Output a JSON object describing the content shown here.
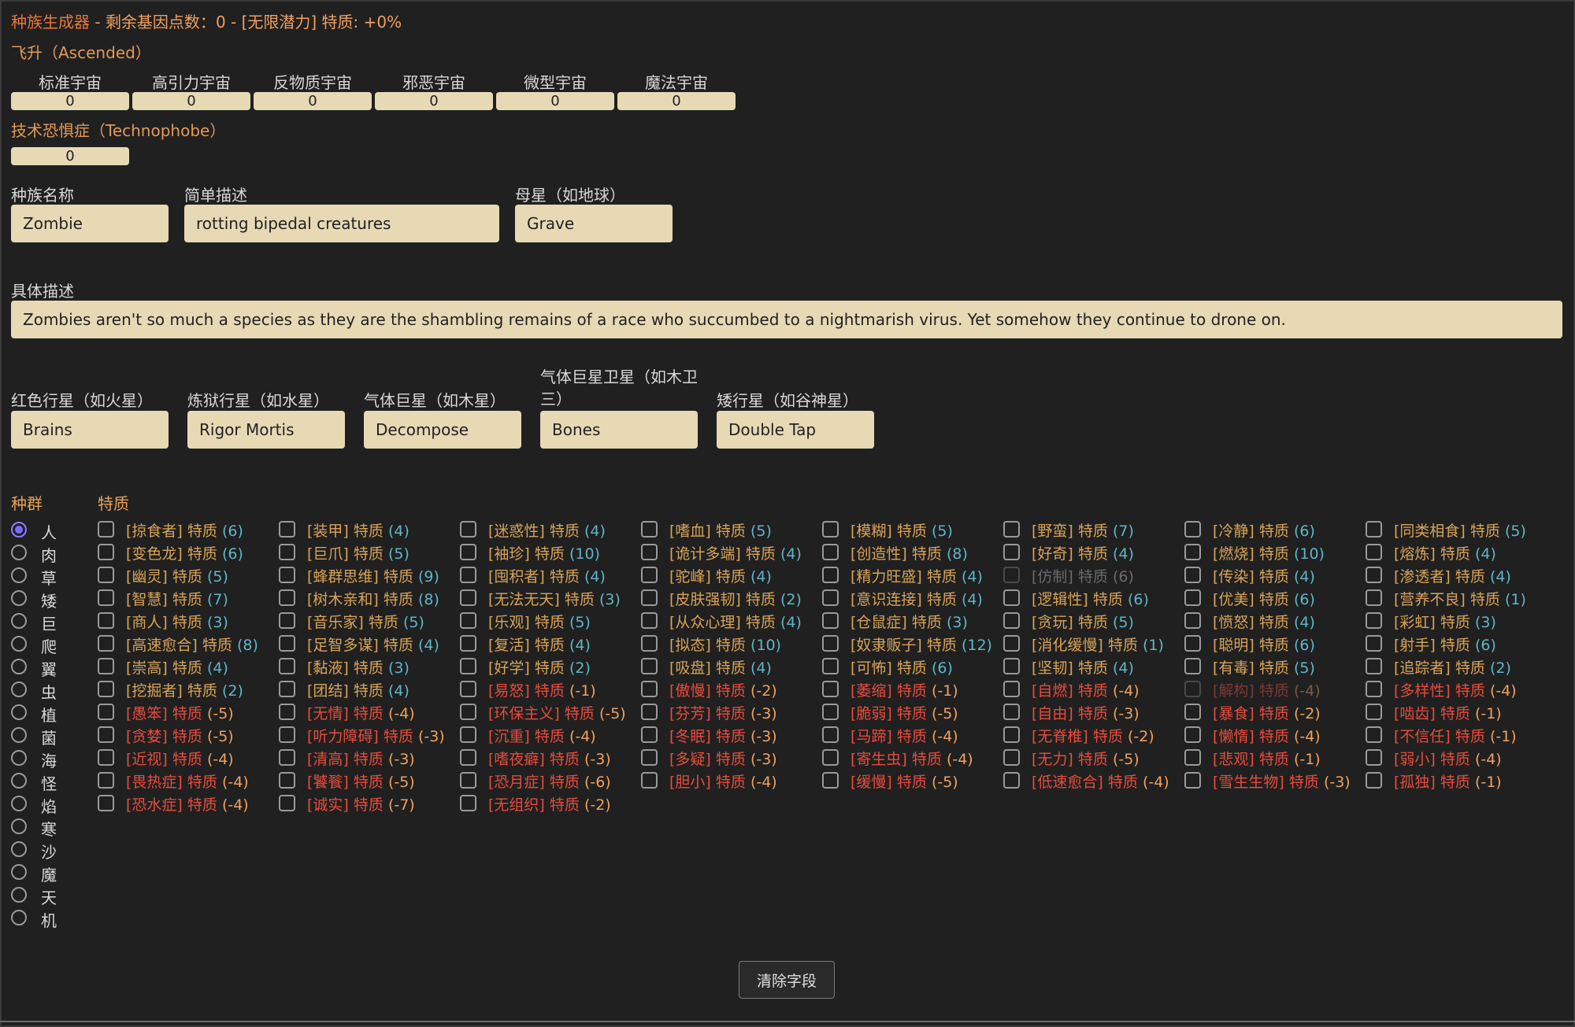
{
  "header": {
    "title": "种族生成器",
    "separator": " - ",
    "points_label": "剩余基因点数：",
    "points_value": "0 - [无限潜力] 特质: +0%"
  },
  "ascended": {
    "title": "飞升（Ascended）",
    "universes": [
      {
        "label": "标准宇宙",
        "value": "0"
      },
      {
        "label": "高引力宇宙",
        "value": "0"
      },
      {
        "label": "反物质宇宙",
        "value": "0"
      },
      {
        "label": "邪恶宇宙",
        "value": "0"
      },
      {
        "label": "微型宇宙",
        "value": "0"
      },
      {
        "label": "魔法宇宙",
        "value": "0"
      }
    ]
  },
  "technophobe": {
    "title": "技术恐惧症（Technophobe）",
    "value": "0"
  },
  "fields": {
    "name": {
      "label": "种族名称",
      "value": "Zombie"
    },
    "desc": {
      "label": "简单描述",
      "value": "rotting bipedal creatures"
    },
    "home": {
      "label": "母星（如地球）",
      "value": "Grave"
    },
    "long_desc": {
      "label": "具体描述",
      "value": "Zombies aren't so much a species as they are the shambling remains of a race who succumbed to a nightmarish virus. Yet somehow they continue to drone on."
    },
    "red": {
      "label": "红色行星（如火星）",
      "value": "Brains"
    },
    "hell": {
      "label": "炼狱行星（如水星）",
      "value": "Rigor Mortis"
    },
    "gas": {
      "label": "气体巨星（如木星）",
      "value": "Decompose"
    },
    "gas_moon": {
      "label": "气体巨星卫星（如木卫三）",
      "value": "Bones"
    },
    "dwarf": {
      "label": "矮行星（如谷神星）",
      "value": "Double Tap"
    }
  },
  "genus": {
    "title": "种群",
    "options": [
      "人",
      "肉",
      "草",
      "矮",
      "巨",
      "爬",
      "翼",
      "虫",
      "植",
      "菌",
      "海",
      "怪",
      "焰",
      "寒",
      "沙",
      "魔",
      "天",
      "机"
    ],
    "selected": 0
  },
  "traits": {
    "title": "特质",
    "suffix": "特质",
    "columns": [
      [
        {
          "n": "[掠食者]",
          "v": "(6)",
          "t": "pos"
        },
        {
          "n": "[变色龙]",
          "v": "(6)",
          "t": "pos"
        },
        {
          "n": "[幽灵]",
          "v": "(5)",
          "t": "pos"
        },
        {
          "n": "[智慧]",
          "v": "(7)",
          "t": "pos"
        },
        {
          "n": "[商人]",
          "v": "(3)",
          "t": "pos"
        },
        {
          "n": "[高速愈合]",
          "v": "(8)",
          "t": "pos"
        },
        {
          "n": "[崇高]",
          "v": "(4)",
          "t": "pos"
        },
        {
          "n": "[挖掘者]",
          "v": "(2)",
          "t": "pos"
        },
        {
          "n": "[愚笨]",
          "v": "(-5)",
          "t": "neg"
        },
        {
          "n": "[贪婪]",
          "v": "(-5)",
          "t": "neg"
        },
        {
          "n": "[近视]",
          "v": "(-4)",
          "t": "neg"
        },
        {
          "n": "[畏热症]",
          "v": "(-4)",
          "t": "neg"
        },
        {
          "n": "[恐水症]",
          "v": "(-4)",
          "t": "neg"
        }
      ],
      [
        {
          "n": "[装甲]",
          "v": "(4)",
          "t": "pos"
        },
        {
          "n": "[巨爪]",
          "v": "(5)",
          "t": "pos"
        },
        {
          "n": "[蜂群思维]",
          "v": "(9)",
          "t": "pos"
        },
        {
          "n": "[树木亲和]",
          "v": "(8)",
          "t": "pos"
        },
        {
          "n": "[音乐家]",
          "v": "(5)",
          "t": "pos"
        },
        {
          "n": "[足智多谋]",
          "v": "(4)",
          "t": "pos"
        },
        {
          "n": "[黏液]",
          "v": "(3)",
          "t": "pos"
        },
        {
          "n": "[团结]",
          "v": "(4)",
          "t": "pos"
        },
        {
          "n": "[无情]",
          "v": "(-4)",
          "t": "neg"
        },
        {
          "n": "[听力障碍]",
          "v": "(-3)",
          "t": "neg"
        },
        {
          "n": "[清高]",
          "v": "(-3)",
          "t": "neg"
        },
        {
          "n": "[饕餮]",
          "v": "(-5)",
          "t": "neg"
        },
        {
          "n": "[诚实]",
          "v": "(-7)",
          "t": "neg"
        }
      ],
      [
        {
          "n": "[迷惑性]",
          "v": "(4)",
          "t": "pos"
        },
        {
          "n": "[袖珍]",
          "v": "(10)",
          "t": "pos"
        },
        {
          "n": "[囤积者]",
          "v": "(4)",
          "t": "pos"
        },
        {
          "n": "[无法无天]",
          "v": "(3)",
          "t": "pos"
        },
        {
          "n": "[乐观]",
          "v": "(5)",
          "t": "pos"
        },
        {
          "n": "[复活]",
          "v": "(4)",
          "t": "pos"
        },
        {
          "n": "[好学]",
          "v": "(2)",
          "t": "pos"
        },
        {
          "n": "[易怒]",
          "v": "(-1)",
          "t": "neg"
        },
        {
          "n": "[环保主义]",
          "v": "(-5)",
          "t": "neg"
        },
        {
          "n": "[沉重]",
          "v": "(-4)",
          "t": "neg"
        },
        {
          "n": "[嗜夜癖]",
          "v": "(-3)",
          "t": "neg"
        },
        {
          "n": "[恐月症]",
          "v": "(-6)",
          "t": "neg"
        },
        {
          "n": "[无组织]",
          "v": "(-2)",
          "t": "neg"
        }
      ],
      [
        {
          "n": "[嗜血]",
          "v": "(5)",
          "t": "pos"
        },
        {
          "n": "[诡计多端]",
          "v": "(4)",
          "t": "pos"
        },
        {
          "n": "[驼峰]",
          "v": "(4)",
          "t": "pos"
        },
        {
          "n": "[皮肤强韧]",
          "v": "(2)",
          "t": "pos"
        },
        {
          "n": "[从众心理]",
          "v": "(4)",
          "t": "pos"
        },
        {
          "n": "[拟态]",
          "v": "(10)",
          "t": "pos"
        },
        {
          "n": "[吸盘]",
          "v": "(4)",
          "t": "pos"
        },
        {
          "n": "[傲慢]",
          "v": "(-2)",
          "t": "neg"
        },
        {
          "n": "[芬芳]",
          "v": "(-3)",
          "t": "neg"
        },
        {
          "n": "[冬眠]",
          "v": "(-3)",
          "t": "neg"
        },
        {
          "n": "[多疑]",
          "v": "(-3)",
          "t": "neg"
        },
        {
          "n": "[胆小]",
          "v": "(-4)",
          "t": "neg"
        }
      ],
      [
        {
          "n": "[模糊]",
          "v": "(5)",
          "t": "pos"
        },
        {
          "n": "[创造性]",
          "v": "(8)",
          "t": "pos"
        },
        {
          "n": "[精力旺盛]",
          "v": "(4)",
          "t": "pos"
        },
        {
          "n": "[意识连接]",
          "v": "(4)",
          "t": "pos"
        },
        {
          "n": "[仓鼠症]",
          "v": "(3)",
          "t": "pos"
        },
        {
          "n": "[奴隶贩子]",
          "v": "(12)",
          "t": "pos"
        },
        {
          "n": "[可怖]",
          "v": "(6)",
          "t": "pos"
        },
        {
          "n": "[萎缩]",
          "v": "(-1)",
          "t": "neg"
        },
        {
          "n": "[脆弱]",
          "v": "(-5)",
          "t": "neg"
        },
        {
          "n": "[马蹄]",
          "v": "(-4)",
          "t": "neg"
        },
        {
          "n": "[寄生虫]",
          "v": "(-4)",
          "t": "neg"
        },
        {
          "n": "[缓慢]",
          "v": "(-5)",
          "t": "neg"
        }
      ],
      [
        {
          "n": "[野蛮]",
          "v": "(7)",
          "t": "pos"
        },
        {
          "n": "[好奇]",
          "v": "(4)",
          "t": "pos"
        },
        {
          "n": "[仿制]",
          "v": "(6)",
          "t": "pos",
          "d": true
        },
        {
          "n": "[逻辑性]",
          "v": "(6)",
          "t": "pos"
        },
        {
          "n": "[贪玩]",
          "v": "(5)",
          "t": "pos"
        },
        {
          "n": "[消化缓慢]",
          "v": "(1)",
          "t": "pos"
        },
        {
          "n": "[坚韧]",
          "v": "(4)",
          "t": "pos"
        },
        {
          "n": "[自燃]",
          "v": "(-4)",
          "t": "neg"
        },
        {
          "n": "[自由]",
          "v": "(-3)",
          "t": "neg"
        },
        {
          "n": "[无脊椎]",
          "v": "(-2)",
          "t": "neg"
        },
        {
          "n": "[无力]",
          "v": "(-5)",
          "t": "neg"
        },
        {
          "n": "[低速愈合]",
          "v": "(-4)",
          "t": "neg"
        }
      ],
      [
        {
          "n": "[冷静]",
          "v": "(6)",
          "t": "pos"
        },
        {
          "n": "[燃烧]",
          "v": "(10)",
          "t": "pos"
        },
        {
          "n": "[传染]",
          "v": "(4)",
          "t": "pos"
        },
        {
          "n": "[优美]",
          "v": "(6)",
          "t": "pos"
        },
        {
          "n": "[愤怒]",
          "v": "(4)",
          "t": "pos"
        },
        {
          "n": "[聪明]",
          "v": "(6)",
          "t": "pos"
        },
        {
          "n": "[有毒]",
          "v": "(5)",
          "t": "pos"
        },
        {
          "n": "[解构]",
          "v": "(-4)",
          "t": "neg",
          "d": true
        },
        {
          "n": "[暴食]",
          "v": "(-2)",
          "t": "neg"
        },
        {
          "n": "[懒惰]",
          "v": "(-4)",
          "t": "neg"
        },
        {
          "n": "[悲观]",
          "v": "(-1)",
          "t": "neg"
        },
        {
          "n": "[雪生生物]",
          "v": "(-3)",
          "t": "neg"
        }
      ],
      [
        {
          "n": "[同类相食]",
          "v": "(5)",
          "t": "pos"
        },
        {
          "n": "[熔炼]",
          "v": "(4)",
          "t": "pos"
        },
        {
          "n": "[渗透者]",
          "v": "(4)",
          "t": "pos"
        },
        {
          "n": "[营养不良]",
          "v": "(1)",
          "t": "pos"
        },
        {
          "n": "[彩虹]",
          "v": "(3)",
          "t": "pos"
        },
        {
          "n": "[射手]",
          "v": "(6)",
          "t": "pos"
        },
        {
          "n": "[追踪者]",
          "v": "(2)",
          "t": "pos"
        },
        {
          "n": "[多样性]",
          "v": "(-4)",
          "t": "neg"
        },
        {
          "n": "[啮齿]",
          "v": "(-1)",
          "t": "neg"
        },
        {
          "n": "[不信任]",
          "v": "(-1)",
          "t": "neg"
        },
        {
          "n": "[弱小]",
          "v": "(-4)",
          "t": "neg"
        },
        {
          "n": "[孤独]",
          "v": "(-1)",
          "t": "neg"
        }
      ]
    ]
  },
  "actions": {
    "clear_label": "清除字段"
  },
  "colors": {
    "accent": "#e8773a",
    "field_bg": "#e6d9b4",
    "positive": "#d8a358",
    "negative": "#e84c3d",
    "radio": "#7b6cff"
  }
}
